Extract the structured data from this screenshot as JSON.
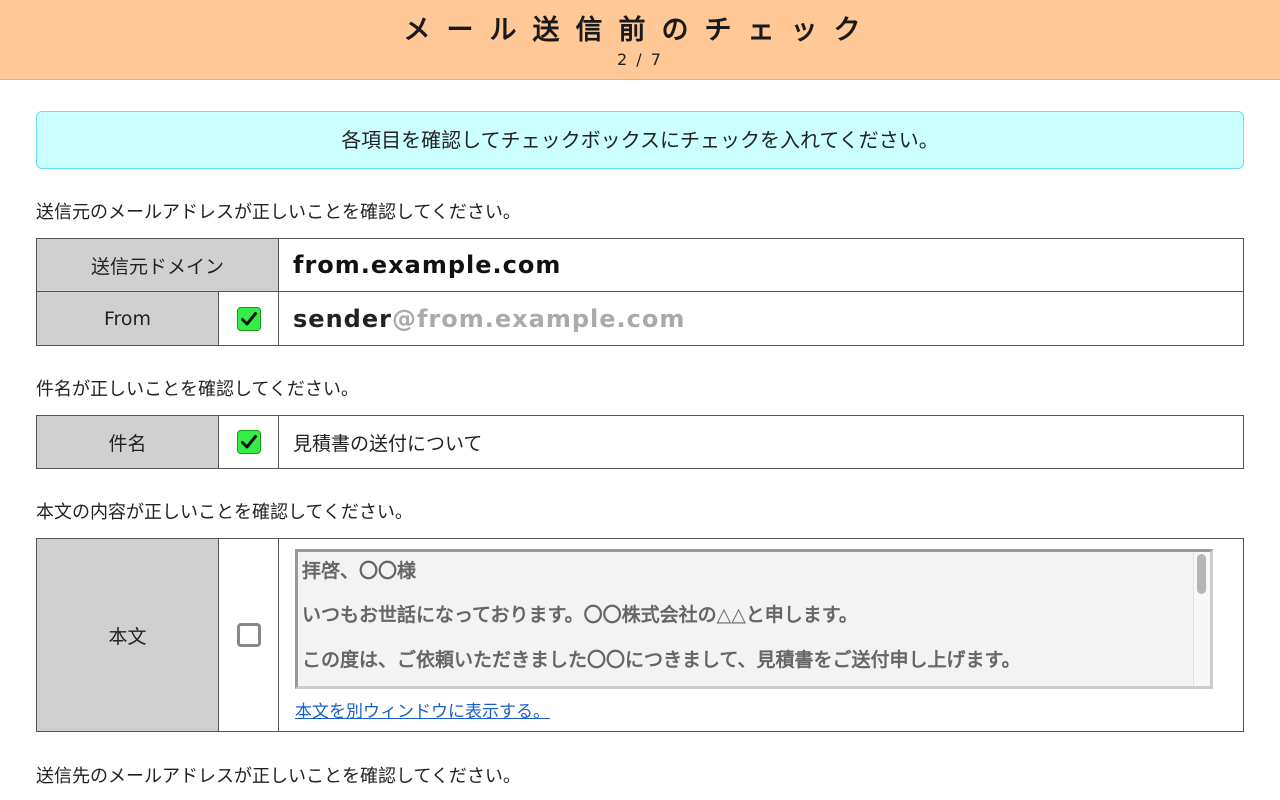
{
  "header": {
    "title": "メール送信前のチェック",
    "step": "2 / 7"
  },
  "notice": "各項目を確認してチェックボックスにチェックを入れてください。",
  "sections": {
    "from": {
      "prompt": "送信元のメールアドレスが正しいことを確認してください。",
      "domain_label": "送信元ドメイン",
      "domain_value": "from.example.com",
      "from_label": "From",
      "from_checked": true,
      "from_local": "sender",
      "from_domain": "@from.example.com"
    },
    "subject": {
      "prompt": "件名が正しいことを確認してください。",
      "label": "件名",
      "checked": true,
      "value": "見積書の送付について"
    },
    "body": {
      "prompt": "本文の内容が正しいことを確認してください。",
      "label": "本文",
      "checked": false,
      "lines": [
        "拝啓、〇〇様",
        "いつもお世話になっております。〇〇株式会社の△△と申します。",
        "この度は、ご依頼いただきました〇〇につきまして、見積書をご送付申し上げます。"
      ],
      "open_link": "本文を別ウィンドウに表示する。"
    },
    "to": {
      "prompt": "送信先のメールアドレスが正しいことを確認してください。"
    }
  },
  "colors": {
    "header_bg": "#ffc896",
    "notice_bg": "#ccffff",
    "label_bg": "#d0d0d0",
    "check_on": "#33ee44",
    "link": "#1a5fc8"
  }
}
